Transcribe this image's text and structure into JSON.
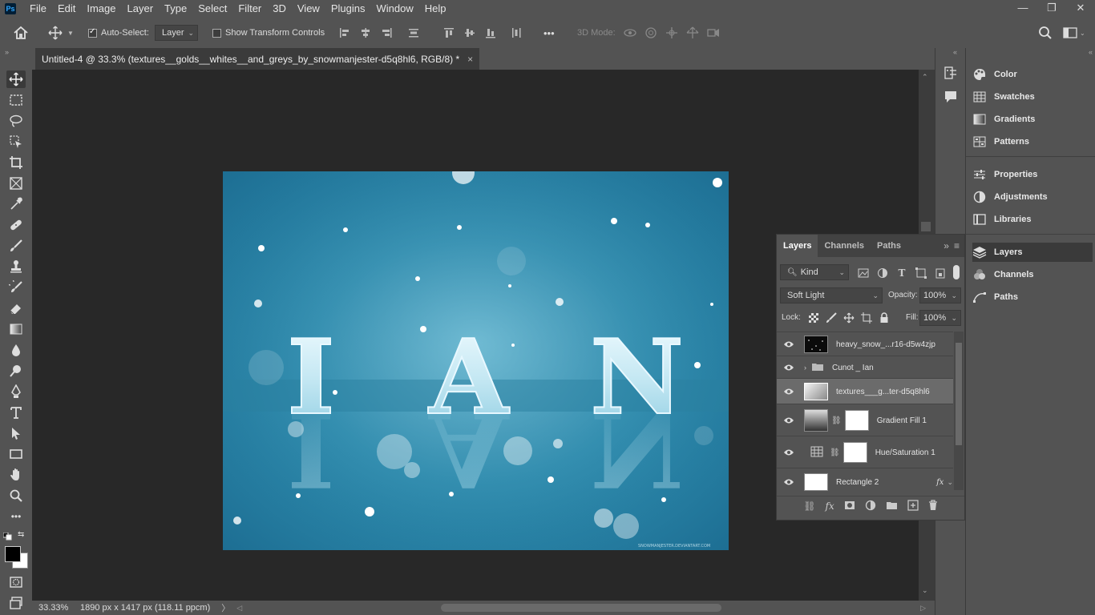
{
  "menu": {
    "logo": "Ps",
    "items": [
      "File",
      "Edit",
      "Image",
      "Layer",
      "Type",
      "Select",
      "Filter",
      "3D",
      "View",
      "Plugins",
      "Window",
      "Help"
    ]
  },
  "window_controls": [
    "—",
    "❐",
    "✕"
  ],
  "options": {
    "auto_select_label": "Auto-Select:",
    "auto_select_value": "Layer",
    "show_transform_label": "Show Transform Controls",
    "mode_3d_label": "3D Mode:",
    "more_label": "•••"
  },
  "document": {
    "tab_title": "Untitled-4 @ 33.3% (textures__golds__whites__and_greys_by_snowmanjester-d5q8hl6, RGB/8) *",
    "close": "×",
    "artwork_text": "I A N",
    "watermark": "SNOWMANJESTER.DEVIANTART.COM"
  },
  "status": {
    "zoom": "33.33%",
    "size": "1890 px x 1417 px (118.11 ppcm)",
    "arrow": "〉"
  },
  "right_panels": {
    "group1": [
      "Color",
      "Swatches",
      "Gradients",
      "Patterns"
    ],
    "group2": [
      "Properties",
      "Adjustments",
      "Libraries"
    ],
    "group3": [
      "Layers",
      "Channels",
      "Paths"
    ]
  },
  "layers_panel": {
    "tabs": [
      "Layers",
      "Channels",
      "Paths"
    ],
    "filter_kind": "Kind",
    "blend_mode": "Soft Light",
    "opacity_label": "Opacity:",
    "opacity_value": "100%",
    "lock_label": "Lock:",
    "fill_label": "Fill:",
    "fill_value": "100%",
    "layers": [
      {
        "name": "heavy_snow_...r16-d5w4zjp"
      },
      {
        "name": "Cunot _ Ian"
      },
      {
        "name": "textures___g...ter-d5q8hl6"
      },
      {
        "name": "Gradient Fill 1"
      },
      {
        "name": "Hue/Saturation 1"
      },
      {
        "name": "Rectangle 2",
        "fx": "fx"
      }
    ]
  }
}
